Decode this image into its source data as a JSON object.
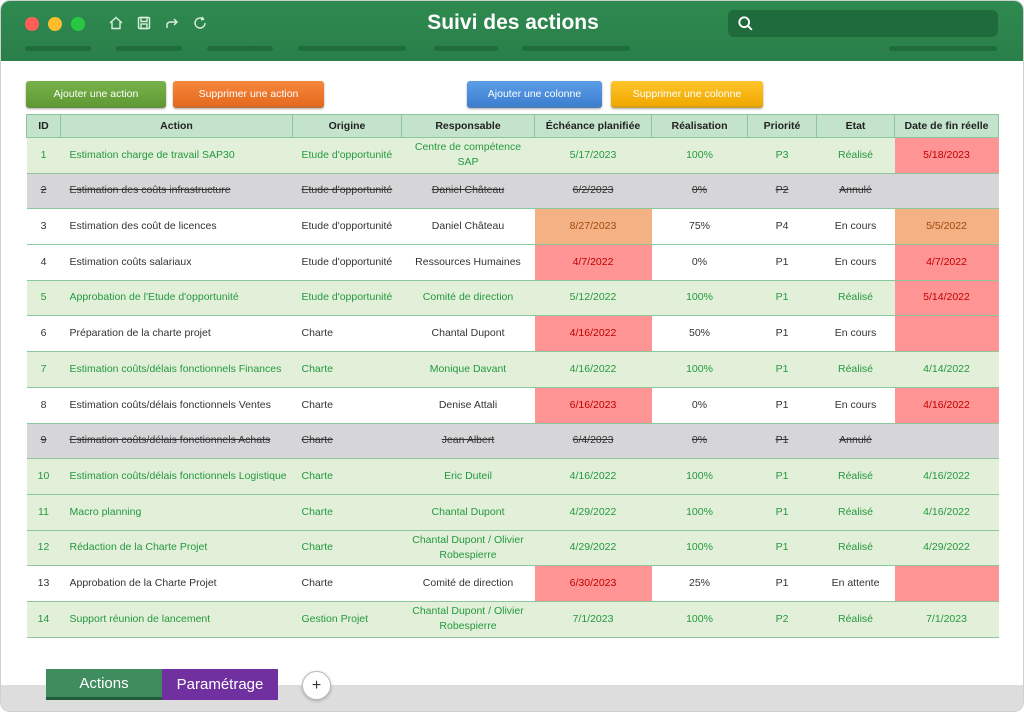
{
  "app": {
    "title": "Suivi des actions",
    "icons": [
      "home-icon",
      "save-icon",
      "share-icon",
      "refresh-icon",
      "search-icon"
    ]
  },
  "toolbar": {
    "add_action": "Ajouter une action",
    "delete_action": "Supprimer une action",
    "add_column": "Ajouter une colonne",
    "delete_column": "Supprimer une colonne"
  },
  "colors": {
    "titlebar": "#2e8a4f",
    "done_row_bg": "#e2f0d9",
    "done_text": "#24983f",
    "cancel_row_bg": "#d6d6d8",
    "late_bg": "#ff9494",
    "late_text": "#c00000",
    "soon_bg": "#f4b183",
    "tab_actions": "#3f8c5f",
    "tab_param": "#7030a0"
  },
  "table": {
    "headers": [
      "ID",
      "Action",
      "Origine",
      "Responsable",
      "Échéance planifiée",
      "Réalisation",
      "Priorité",
      "Etat",
      "Date de fin réelle"
    ],
    "rows": [
      {
        "id": "1",
        "action": "Estimation charge de travail SAP30",
        "origine": "Etude d'opportunité",
        "responsable": "Centre de compétence SAP",
        "echeance": "5/17/2023",
        "realisation": "100%",
        "priorite": "P3",
        "etat": "Réalisé",
        "fin": "5/18/2023"
      },
      {
        "id": "2",
        "action": "Estimation des coûts infrastructure",
        "origine": "Etude d'opportunité",
        "responsable": "Daniel Château",
        "echeance": "6/2/2023",
        "realisation": "0%",
        "priorite": "P2",
        "etat": "Annulé",
        "fin": ""
      },
      {
        "id": "3",
        "action": "Estimation des coût de licences",
        "origine": "Etude d'opportunité",
        "responsable": "Daniel Château",
        "echeance": "8/27/2023",
        "realisation": "75%",
        "priorite": "P4",
        "etat": "En cours",
        "fin": "5/5/2022"
      },
      {
        "id": "4",
        "action": "Estimation coûts salariaux",
        "origine": "Etude d'opportunité",
        "responsable": "Ressources Humaines",
        "echeance": "4/7/2022",
        "realisation": "0%",
        "priorite": "P1",
        "etat": "En cours",
        "fin": "4/7/2022"
      },
      {
        "id": "5",
        "action": "Approbation de l'Etude d'opportunité",
        "origine": "Etude d'opportunité",
        "responsable": "Comité de direction",
        "echeance": "5/12/2022",
        "realisation": "100%",
        "priorite": "P1",
        "etat": "Réalisé",
        "fin": "5/14/2022"
      },
      {
        "id": "6",
        "action": "Préparation de la charte projet",
        "origine": "Charte",
        "responsable": "Chantal Dupont",
        "echeance": "4/16/2022",
        "realisation": "50%",
        "priorite": "P1",
        "etat": "En cours",
        "fin": ""
      },
      {
        "id": "7",
        "action": "Estimation coûts/délais fonctionnels Finances",
        "origine": "Charte",
        "responsable": "Monique Davant",
        "echeance": "4/16/2022",
        "realisation": "100%",
        "priorite": "P1",
        "etat": "Réalisé",
        "fin": "4/14/2022"
      },
      {
        "id": "8",
        "action": "Estimation coûts/délais fonctionnels Ventes",
        "origine": "Charte",
        "responsable": "Denise Attali",
        "echeance": "6/16/2023",
        "realisation": "0%",
        "priorite": "P1",
        "etat": "En cours",
        "fin": "4/16/2022"
      },
      {
        "id": "9",
        "action": "Estimation coûts/délais fonctionnels Achats",
        "origine": "Charte",
        "responsable": "Jean Albert",
        "echeance": "6/4/2023",
        "realisation": "0%",
        "priorite": "P1",
        "etat": "Annulé",
        "fin": ""
      },
      {
        "id": "10",
        "action": "Estimation coûts/délais fonctionnels Logistique",
        "origine": "Charte",
        "responsable": "Eric Duteil",
        "echeance": "4/16/2022",
        "realisation": "100%",
        "priorite": "P1",
        "etat": "Réalisé",
        "fin": "4/16/2022"
      },
      {
        "id": "11",
        "action": "Macro planning",
        "origine": "Charte",
        "responsable": "Chantal Dupont",
        "echeance": "4/29/2022",
        "realisation": "100%",
        "priorite": "P1",
        "etat": "Réalisé",
        "fin": "4/16/2022"
      },
      {
        "id": "12",
        "action": "Rédaction de la Charte Projet",
        "origine": "Charte",
        "responsable": "Chantal Dupont / Olivier Robespierre",
        "echeance": "4/29/2022",
        "realisation": "100%",
        "priorite": "P1",
        "etat": "Réalisé",
        "fin": "4/29/2022"
      },
      {
        "id": "13",
        "action": "Approbation de la Charte Projet",
        "origine": "Charte",
        "responsable": "Comité de direction",
        "echeance": "6/30/2023",
        "realisation": "25%",
        "priorite": "P1",
        "etat": "En attente",
        "fin": ""
      },
      {
        "id": "14",
        "action": "Support réunion de lancement",
        "origine": "Gestion Projet",
        "responsable": "Chantal Dupont / Olivier Robespierre",
        "echeance": "7/1/2023",
        "realisation": "100%",
        "priorite": "P2",
        "etat": "Réalisé",
        "fin": "7/1/2023"
      }
    ]
  },
  "tabs": [
    {
      "label": "Actions"
    },
    {
      "label": "Paramétrage"
    }
  ],
  "add_tab_label": "+"
}
